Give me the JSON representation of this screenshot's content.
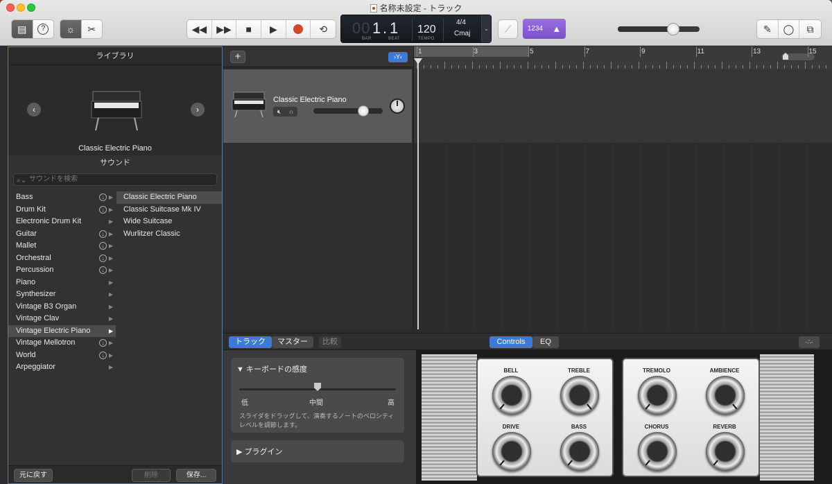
{
  "window": {
    "title": "名称未設定 - トラック"
  },
  "lcd": {
    "bar": "1",
    "beat": "1",
    "bar_label": "BAR",
    "beat_label": "BEAT",
    "tempo": "120",
    "tempo_label": "TEMPO",
    "time_sig": "4/4",
    "key": "Cmaj",
    "prefix": "00"
  },
  "toolbar": {
    "count_in": "1234",
    "master_volume_fraction": 0.68
  },
  "library": {
    "title": "ライブラリ",
    "instrument_name": "Classic Electric Piano",
    "sound_header": "サウンド",
    "search_placeholder": "サウンドを検索",
    "categories": [
      {
        "label": "Bass",
        "download": true
      },
      {
        "label": "Drum Kit",
        "download": true
      },
      {
        "label": "Electronic Drum Kit",
        "download": false
      },
      {
        "label": "Guitar",
        "download": true
      },
      {
        "label": "Mallet",
        "download": true
      },
      {
        "label": "Orchestral",
        "download": true
      },
      {
        "label": "Percussion",
        "download": true
      },
      {
        "label": "Piano",
        "download": false
      },
      {
        "label": "Synthesizer",
        "download": false
      },
      {
        "label": "Vintage B3 Organ",
        "download": false
      },
      {
        "label": "Vintage Clav",
        "download": false
      },
      {
        "label": "Vintage Electric Piano",
        "download": false,
        "selected": true
      },
      {
        "label": "Vintage Mellotron",
        "download": true
      },
      {
        "label": "World",
        "download": true
      },
      {
        "label": "Arpeggiator",
        "download": false
      }
    ],
    "sounds": [
      {
        "label": "Classic Electric Piano",
        "selected": true
      },
      {
        "label": "Classic Suitcase Mk IV"
      },
      {
        "label": "Wide Suitcase"
      },
      {
        "label": "Wurlitzer Classic"
      }
    ],
    "revert_label": "元に戻す",
    "delete_label": "削除",
    "save_label": "保存..."
  },
  "track": {
    "name": "Classic Electric Piano",
    "volume_fraction": 0.72
  },
  "ruler": {
    "marks": [
      "1",
      "3",
      "5",
      "7",
      "9",
      "11",
      "13",
      "15"
    ]
  },
  "smart_controls": {
    "tab_track": "トラック",
    "tab_master": "マスター",
    "tab_compare": "比較",
    "view_controls": "Controls",
    "view_eq": "EQ",
    "keyboard_sensitivity_title": "キーボードの感度",
    "slider_low": "低",
    "slider_mid": "中間",
    "slider_high": "高",
    "description": "スライダをドラッグして、演奏するノートのベロシティレベルを調節します。",
    "plugins_title": "プラグイン",
    "knobs_left": [
      "BELL",
      "TREBLE",
      "DRIVE",
      "BASS"
    ],
    "knobs_right": [
      "TREMOLO",
      "AMBIENCE",
      "CHORUS",
      "REVERB"
    ]
  }
}
